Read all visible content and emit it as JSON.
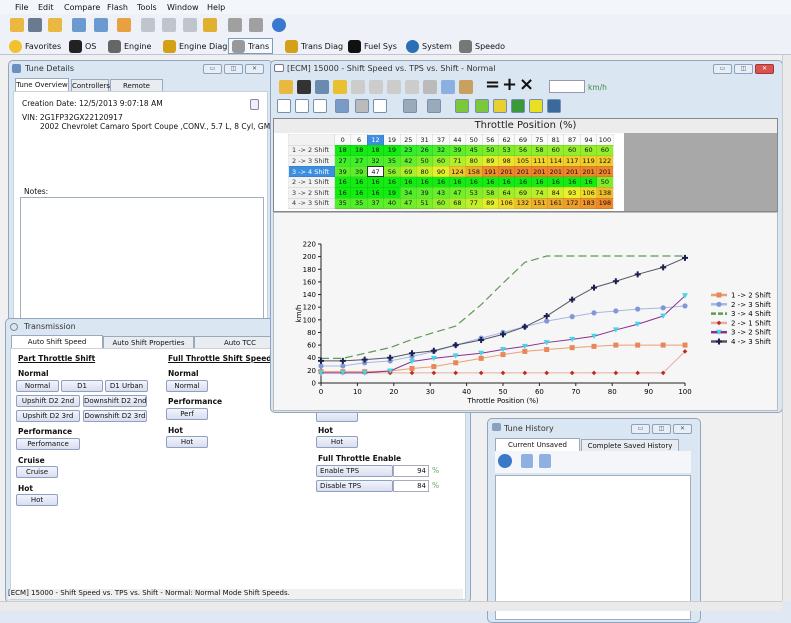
{
  "menu": [
    "File",
    "Edit",
    "Compare",
    "Flash",
    "Tools",
    "Window",
    "Help"
  ],
  "toolbar_icons": [
    "open-folder-icon",
    "save-icon",
    "open-folder-up-icon",
    "vehicle-info-icon",
    "vehicle-info-alt-icon",
    "folder-flash-icon",
    "table-icon",
    "table-icon",
    "table-icon",
    "swap-icon",
    "diamond-left-icon",
    "diamond-right-icon",
    "info-icon"
  ],
  "nav": [
    {
      "label": "Favorites",
      "icon": "star-icon",
      "color": "#f2c12e"
    },
    {
      "label": "OS",
      "icon": "chip-icon",
      "color": "#222222"
    },
    {
      "label": "Engine",
      "icon": "engine-icon",
      "color": "#666666"
    },
    {
      "label": "Engine Diag",
      "icon": "engine-diag-icon",
      "color": "#d4a017"
    },
    {
      "label": "Trans",
      "icon": "gear-icon",
      "color": "#999999",
      "active": true
    },
    {
      "label": "Trans Diag",
      "icon": "gear-diag-icon",
      "color": "#d4a017"
    },
    {
      "label": "Fuel Sys",
      "icon": "fuel-pump-icon",
      "color": "#111111"
    },
    {
      "label": "System",
      "icon": "globe-icon",
      "color": "#2a6fb5"
    },
    {
      "label": "Speedo",
      "icon": "speedometer-icon",
      "color": "#777777"
    }
  ],
  "tune_details": {
    "title": "Tune Details",
    "tabs": [
      "Tune Overview",
      "Controllers",
      "Remote Tuning"
    ],
    "creation_date": "Creation Date: 12/5/2013 9:07:18 AM",
    "vin": "VIN: 2G1FP32GX22120917",
    "vehicle": "2002 Chevrolet Camaro Sport Coupe ,CONV., 5.7 L, 8 Cyl, GM_P01",
    "notes_label": "Notes:"
  },
  "transmission": {
    "title": "Transmission",
    "tabs": [
      "Auto Shift Speed",
      "Auto Shift Properties",
      "Auto TCC"
    ],
    "part_throttle": {
      "heading": "Part Throttle Shift",
      "normal": "Normal",
      "normal_buttons": [
        "Normal",
        "D1",
        "D1 Urban",
        "Upshift D2 2nd",
        "Downshift D2 2nd",
        "Upshift D2 3rd",
        "Downshift D2 3rd"
      ],
      "performance": "Performance",
      "performance_button": "Perfomance",
      "cruise": "Cruise",
      "cruise_button": "Cruise",
      "hot": "Hot",
      "hot_button": "Hot"
    },
    "full_throttle": {
      "heading": "Full Throttle Shift Speed",
      "normal": "Normal",
      "normal_button": "Normal",
      "performance": "Performance",
      "perf_button": "Perf",
      "hot": "Hot",
      "hot_button": "Hot"
    },
    "col3": {
      "hot": "Hot",
      "hot_button": "Hot",
      "enable_heading": "Full Throttle Enable",
      "enable_label": "Enable TPS",
      "enable_value": "94",
      "disable_label": "Disable TPS",
      "disable_value": "84",
      "unit": "%"
    }
  },
  "ecm": {
    "title": "[ECM] 15000 - Shift Speed vs. TPS vs. Shift - Normal",
    "unit": "km/h",
    "input_value": "",
    "axis_title": "Throttle Position (%)",
    "columns": [
      "0",
      "6",
      "12",
      "19",
      "25",
      "31",
      "37",
      "44",
      "50",
      "56",
      "62",
      "69",
      "75",
      "81",
      "87",
      "94",
      "100"
    ],
    "selected_column": 2,
    "selected_row": 2,
    "rows": [
      {
        "label": "1 -> 2 Shift",
        "values": [
          18,
          18,
          18,
          19,
          23,
          26,
          32,
          39,
          45,
          50,
          53,
          56,
          58,
          60,
          60,
          60,
          60
        ]
      },
      {
        "label": "2 -> 3 Shift",
        "values": [
          27,
          27,
          32,
          35,
          42,
          50,
          60,
          71,
          80,
          89,
          98,
          105,
          111,
          114,
          117,
          119,
          122
        ]
      },
      {
        "label": "3 -> 4 Shift",
        "values": [
          39,
          39,
          47,
          56,
          69,
          80,
          90,
          124,
          158,
          191,
          201,
          201,
          201,
          201,
          201,
          201,
          201
        ]
      },
      {
        "label": "2 -> 1 Shift",
        "values": [
          16,
          16,
          16,
          16,
          16,
          16,
          16,
          16,
          16,
          16,
          16,
          16,
          16,
          16,
          16,
          16,
          50
        ]
      },
      {
        "label": "3 -> 2 Shift",
        "values": [
          16,
          16,
          16,
          19,
          34,
          39,
          43,
          47,
          53,
          58,
          64,
          69,
          74,
          84,
          93,
          106,
          138
        ]
      },
      {
        "label": "4 -> 3 Shift",
        "values": [
          35,
          35,
          37,
          40,
          47,
          51,
          60,
          68,
          77,
          89,
          106,
          132,
          151,
          161,
          172,
          183,
          198
        ]
      }
    ]
  },
  "chart_data": {
    "type": "line",
    "xlabel": "Throttle Position (%)",
    "ylabel": "km/h",
    "xlim": [
      0,
      100
    ],
    "ylim": [
      0,
      220
    ],
    "xticks": [
      0,
      10,
      20,
      30,
      40,
      50,
      60,
      70,
      80,
      90,
      100
    ],
    "yticks": [
      0,
      20,
      40,
      60,
      80,
      100,
      120,
      140,
      160,
      180,
      200,
      220
    ],
    "legend": "right",
    "x": [
      0,
      6,
      12,
      19,
      25,
      31,
      37,
      44,
      50,
      56,
      62,
      69,
      75,
      81,
      87,
      94,
      100
    ],
    "series": [
      {
        "name": "1 -> 2 Shift",
        "line": "#e9a070",
        "marker": "square",
        "marker_color": "#e8875a",
        "values": [
          18,
          18,
          18,
          19,
          23,
          26,
          32,
          39,
          45,
          50,
          53,
          56,
          58,
          60,
          60,
          60,
          60
        ]
      },
      {
        "name": "2 -> 3 Shift",
        "line": "#a8b8e0",
        "marker": "circle",
        "marker_color": "#8098d8",
        "values": [
          27,
          27,
          32,
          35,
          42,
          50,
          60,
          71,
          80,
          89,
          98,
          105,
          111,
          114,
          117,
          119,
          122
        ]
      },
      {
        "name": "3 -> 4 Shift",
        "line": "#5f9a55",
        "marker": "none",
        "dash": true,
        "values": [
          39,
          39,
          47,
          56,
          69,
          80,
          90,
          124,
          158,
          191,
          201,
          201,
          201,
          201,
          201,
          201,
          201
        ]
      },
      {
        "name": "2 -> 1 Shift",
        "line": "#e0b0a0",
        "marker": "diamond",
        "marker_color": "#c02828",
        "values": [
          16,
          16,
          16,
          16,
          16,
          16,
          16,
          16,
          16,
          16,
          16,
          16,
          16,
          16,
          16,
          16,
          50
        ]
      },
      {
        "name": "3 -> 2 Shift",
        "line": "#8a3090",
        "marker": "triangle",
        "marker_color": "#40d8e8",
        "values": [
          16,
          16,
          16,
          19,
          34,
          39,
          43,
          47,
          53,
          58,
          64,
          69,
          74,
          84,
          93,
          106,
          138
        ]
      },
      {
        "name": "4 -> 3 Shift",
        "line": "#555566",
        "marker": "star",
        "marker_color": "#1c2050",
        "values": [
          35,
          35,
          37,
          40,
          47,
          51,
          60,
          68,
          77,
          89,
          106,
          132,
          151,
          161,
          172,
          183,
          198
        ]
      }
    ]
  },
  "tune_history": {
    "title": "Tune History",
    "tabs": [
      "Current Unsaved Changes",
      "Complete Saved History Logs"
    ]
  },
  "status": "[ECM] 15000 - Shift Speed vs. TPS vs. Shift - Normal: Normal Mode Shift Speeds."
}
